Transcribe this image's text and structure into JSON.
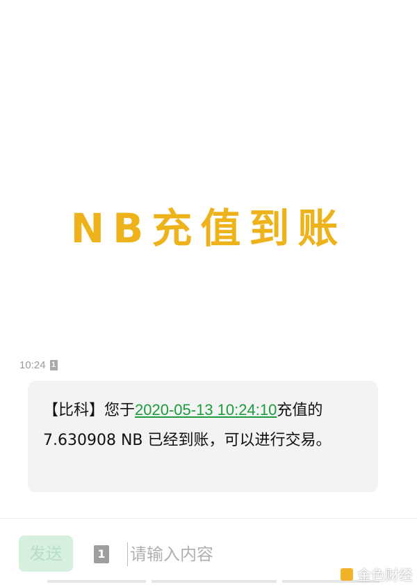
{
  "banner": {
    "title": "NB充值到账"
  },
  "message": {
    "time": "10:24",
    "sim_label": "1",
    "text_prefix": "【比科】您于",
    "date_link": "2020-05-13 10:24:10",
    "text_suffix": "充值的 7.630908 NB 已经到账，可以进行交易。"
  },
  "composer": {
    "send_label": "发送",
    "sim_label": "1",
    "placeholder": "请输入内容"
  },
  "watermark": {
    "text": "金色财经"
  },
  "colors": {
    "accent": "#eeb21a",
    "link": "#1c9c3c",
    "send_button_bg": "#d7efdf",
    "bubble_bg": "#f3f3f3"
  }
}
